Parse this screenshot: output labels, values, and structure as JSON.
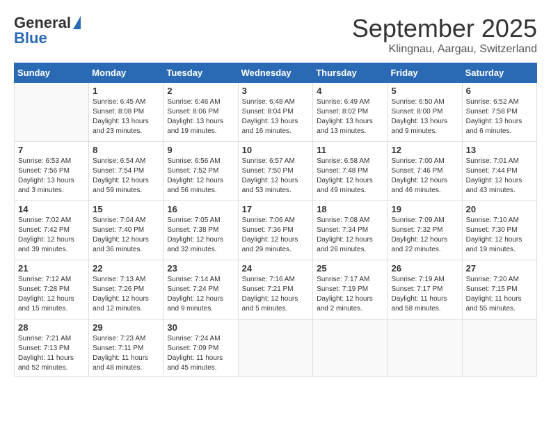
{
  "header": {
    "logo_general": "General",
    "logo_blue": "Blue",
    "month": "September 2025",
    "location": "Klingnau, Aargau, Switzerland"
  },
  "weekdays": [
    "Sunday",
    "Monday",
    "Tuesday",
    "Wednesday",
    "Thursday",
    "Friday",
    "Saturday"
  ],
  "weeks": [
    [
      {
        "day": "",
        "info": ""
      },
      {
        "day": "1",
        "info": "Sunrise: 6:45 AM\nSunset: 8:08 PM\nDaylight: 13 hours\nand 23 minutes."
      },
      {
        "day": "2",
        "info": "Sunrise: 6:46 AM\nSunset: 8:06 PM\nDaylight: 13 hours\nand 19 minutes."
      },
      {
        "day": "3",
        "info": "Sunrise: 6:48 AM\nSunset: 8:04 PM\nDaylight: 13 hours\nand 16 minutes."
      },
      {
        "day": "4",
        "info": "Sunrise: 6:49 AM\nSunset: 8:02 PM\nDaylight: 13 hours\nand 13 minutes."
      },
      {
        "day": "5",
        "info": "Sunrise: 6:50 AM\nSunset: 8:00 PM\nDaylight: 13 hours\nand 9 minutes."
      },
      {
        "day": "6",
        "info": "Sunrise: 6:52 AM\nSunset: 7:58 PM\nDaylight: 13 hours\nand 6 minutes."
      }
    ],
    [
      {
        "day": "7",
        "info": "Sunrise: 6:53 AM\nSunset: 7:56 PM\nDaylight: 13 hours\nand 3 minutes."
      },
      {
        "day": "8",
        "info": "Sunrise: 6:54 AM\nSunset: 7:54 PM\nDaylight: 12 hours\nand 59 minutes."
      },
      {
        "day": "9",
        "info": "Sunrise: 6:56 AM\nSunset: 7:52 PM\nDaylight: 12 hours\nand 56 minutes."
      },
      {
        "day": "10",
        "info": "Sunrise: 6:57 AM\nSunset: 7:50 PM\nDaylight: 12 hours\nand 53 minutes."
      },
      {
        "day": "11",
        "info": "Sunrise: 6:58 AM\nSunset: 7:48 PM\nDaylight: 12 hours\nand 49 minutes."
      },
      {
        "day": "12",
        "info": "Sunrise: 7:00 AM\nSunset: 7:46 PM\nDaylight: 12 hours\nand 46 minutes."
      },
      {
        "day": "13",
        "info": "Sunrise: 7:01 AM\nSunset: 7:44 PM\nDaylight: 12 hours\nand 43 minutes."
      }
    ],
    [
      {
        "day": "14",
        "info": "Sunrise: 7:02 AM\nSunset: 7:42 PM\nDaylight: 12 hours\nand 39 minutes."
      },
      {
        "day": "15",
        "info": "Sunrise: 7:04 AM\nSunset: 7:40 PM\nDaylight: 12 hours\nand 36 minutes."
      },
      {
        "day": "16",
        "info": "Sunrise: 7:05 AM\nSunset: 7:38 PM\nDaylight: 12 hours\nand 32 minutes."
      },
      {
        "day": "17",
        "info": "Sunrise: 7:06 AM\nSunset: 7:36 PM\nDaylight: 12 hours\nand 29 minutes."
      },
      {
        "day": "18",
        "info": "Sunrise: 7:08 AM\nSunset: 7:34 PM\nDaylight: 12 hours\nand 26 minutes."
      },
      {
        "day": "19",
        "info": "Sunrise: 7:09 AM\nSunset: 7:32 PM\nDaylight: 12 hours\nand 22 minutes."
      },
      {
        "day": "20",
        "info": "Sunrise: 7:10 AM\nSunset: 7:30 PM\nDaylight: 12 hours\nand 19 minutes."
      }
    ],
    [
      {
        "day": "21",
        "info": "Sunrise: 7:12 AM\nSunset: 7:28 PM\nDaylight: 12 hours\nand 15 minutes."
      },
      {
        "day": "22",
        "info": "Sunrise: 7:13 AM\nSunset: 7:26 PM\nDaylight: 12 hours\nand 12 minutes."
      },
      {
        "day": "23",
        "info": "Sunrise: 7:14 AM\nSunset: 7:24 PM\nDaylight: 12 hours\nand 9 minutes."
      },
      {
        "day": "24",
        "info": "Sunrise: 7:16 AM\nSunset: 7:21 PM\nDaylight: 12 hours\nand 5 minutes."
      },
      {
        "day": "25",
        "info": "Sunrise: 7:17 AM\nSunset: 7:19 PM\nDaylight: 12 hours\nand 2 minutes."
      },
      {
        "day": "26",
        "info": "Sunrise: 7:19 AM\nSunset: 7:17 PM\nDaylight: 11 hours\nand 58 minutes."
      },
      {
        "day": "27",
        "info": "Sunrise: 7:20 AM\nSunset: 7:15 PM\nDaylight: 11 hours\nand 55 minutes."
      }
    ],
    [
      {
        "day": "28",
        "info": "Sunrise: 7:21 AM\nSunset: 7:13 PM\nDaylight: 11 hours\nand 52 minutes."
      },
      {
        "day": "29",
        "info": "Sunrise: 7:23 AM\nSunset: 7:11 PM\nDaylight: 11 hours\nand 48 minutes."
      },
      {
        "day": "30",
        "info": "Sunrise: 7:24 AM\nSunset: 7:09 PM\nDaylight: 11 hours\nand 45 minutes."
      },
      {
        "day": "",
        "info": ""
      },
      {
        "day": "",
        "info": ""
      },
      {
        "day": "",
        "info": ""
      },
      {
        "day": "",
        "info": ""
      }
    ]
  ]
}
